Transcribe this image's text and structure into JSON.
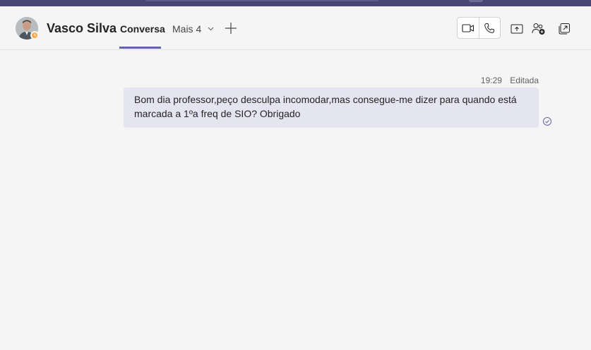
{
  "header": {
    "contact_name": "Vasco Silva",
    "status_color": "#ffaa44",
    "tabs": [
      {
        "label": "Conversa",
        "active": true
      },
      {
        "label": "Mais 4",
        "active": false
      }
    ],
    "add_tab_icon": "plus-icon",
    "actions": [
      "video-call-icon",
      "audio-call-icon",
      "share-screen-icon",
      "add-people-icon",
      "pop-out-icon"
    ]
  },
  "theme": {
    "top_bar": "#464775",
    "accent": "#6264a7",
    "bubble_bg": "#e5e5f1",
    "page_bg": "#f5f5f5"
  },
  "messages": [
    {
      "time": "19:29",
      "edited_label": "Editada",
      "text": "Bom dia professor,peço desculpa incomodar,mas consegue-me dizer para quando está marcada a 1ºa freq de SIO? Obrigado",
      "status_icon": "seen-check-icon"
    }
  ]
}
